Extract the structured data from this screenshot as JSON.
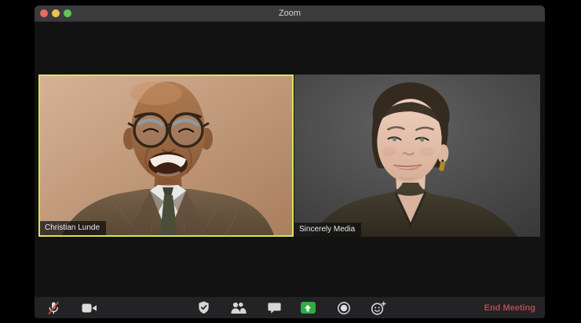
{
  "window": {
    "title": "Zoom"
  },
  "titlebar_controls": [
    "close",
    "minimize",
    "fullscreen"
  ],
  "participants": [
    {
      "name": "Christian Lunde",
      "active_speaker": true
    },
    {
      "name": "Sincerely Media",
      "active_speaker": false
    }
  ],
  "toolbar": {
    "end_meeting_label": "End Meeting",
    "microphone_muted": true,
    "icons": [
      "muted-microphone-icon",
      "video-camera-icon",
      "security-shield-icon",
      "participants-icon",
      "chat-bubble-icon",
      "share-screen-icon",
      "record-icon",
      "reactions-smiley-icon"
    ]
  },
  "colors": {
    "active_speaker_border": "#d9e455",
    "share_screen_green": "#2fae41",
    "end_meeting_red": "#b5494e",
    "mute_slash_red": "#c84b3f",
    "traffic_red": "#ed6a5e",
    "traffic_yellow": "#f5bf4f",
    "traffic_green": "#61c554",
    "titlebar": "#3b3b3d",
    "toolbar": "#232325"
  }
}
